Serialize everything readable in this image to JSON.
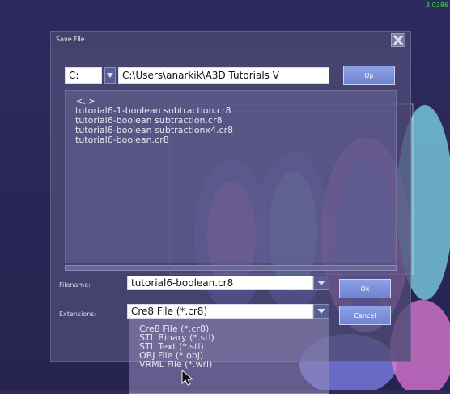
{
  "hud": {
    "fps": "3.0386"
  },
  "dialog": {
    "title": "Save File",
    "drive": "C:",
    "path": "C:\\Users\\anarkik\\A3D Tutorials V",
    "up_label": "Up",
    "files": [
      "<..>",
      "tutorial6-1-boolean subtraction.cr8",
      "tutorial6-boolean subtraction.cr8",
      "tutorial6-boolean subtractionx4.cr8",
      "tutorial6-boolean.cr8"
    ],
    "filename_label": "Filename:",
    "filename_value": "tutorial6-boolean.cr8",
    "ok_label": "Ok",
    "extensions_label": "Extensions:",
    "extension_selected": "Cre8 File (*.cr8)",
    "cancel_label": "Cancel",
    "extension_options": [
      "Cre8 File (*.cr8)",
      "STL Binary (*.stl)",
      "STL Text (*.stl)",
      "OBJ File (*.obj)",
      "VRML File (*.wrl)"
    ]
  },
  "colors": {
    "scene_background": "#2f2a5c",
    "button_blue": "#7a8de0",
    "model_pink": "#e27ad7",
    "model_cyan": "#7fd8ea",
    "model_blue": "#5b64d6"
  }
}
